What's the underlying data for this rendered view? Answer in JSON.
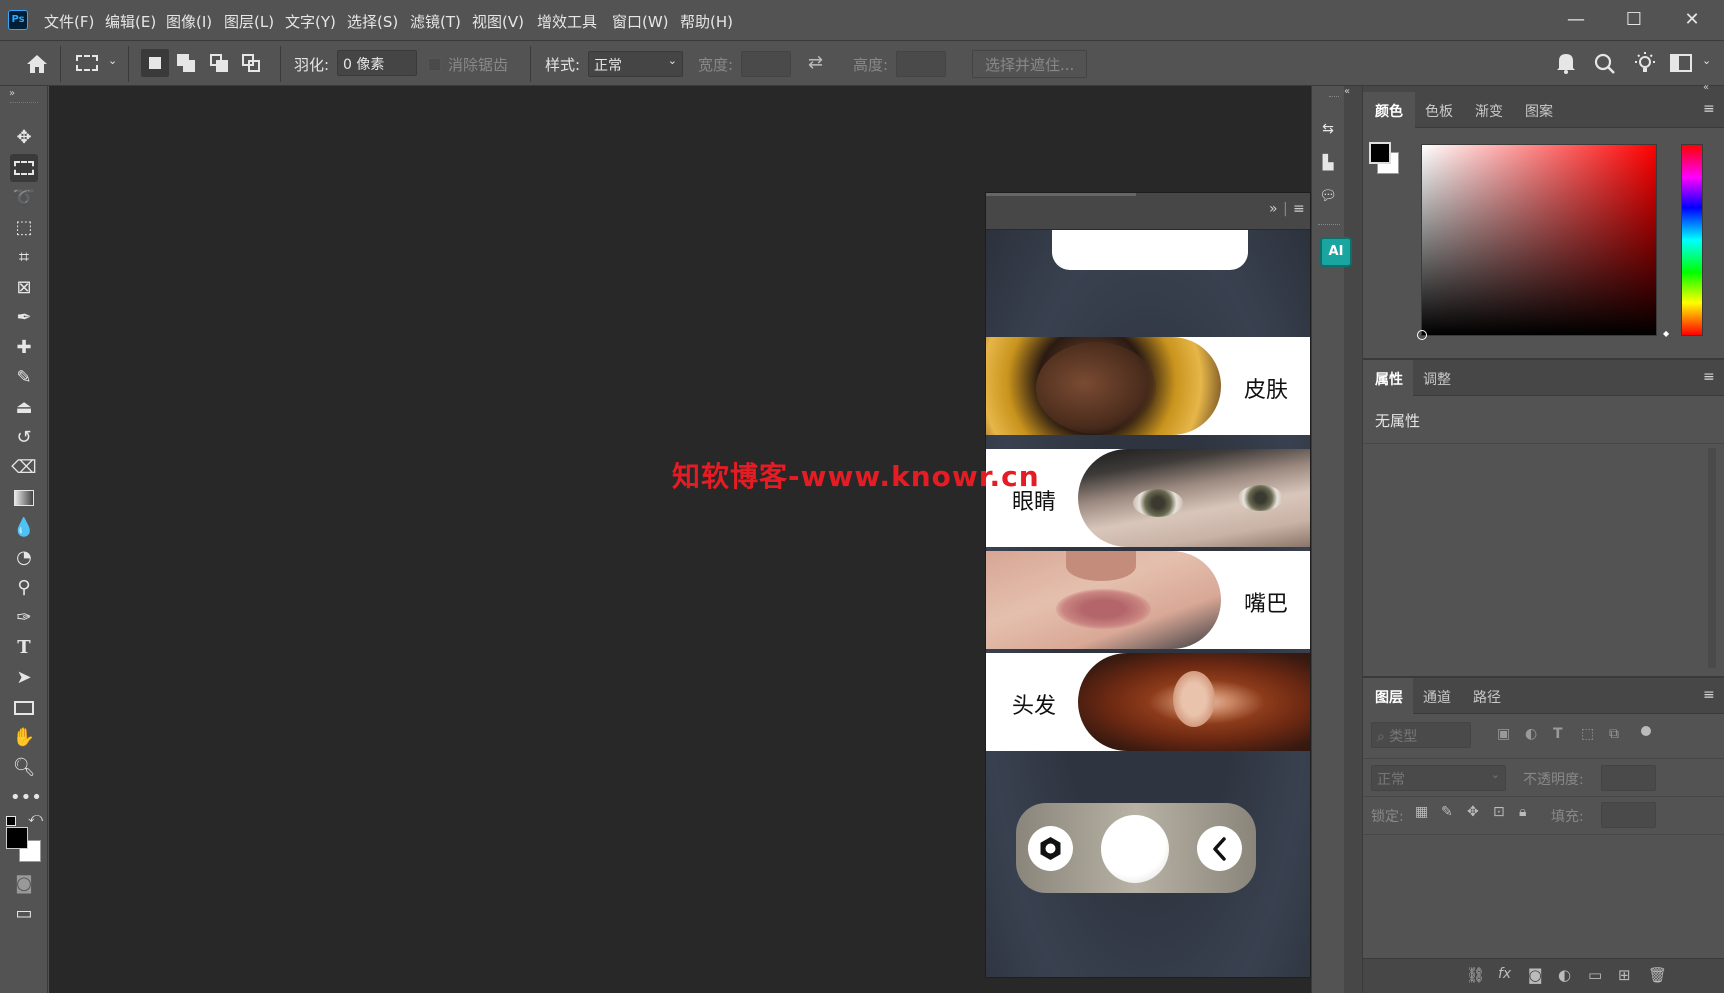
{
  "app": {
    "logo": "Ps"
  },
  "menu": [
    "文件(F)",
    "编辑(E)",
    "图像(I)",
    "图层(L)",
    "文字(Y)",
    "选择(S)",
    "滤镜(T)",
    "视图(V)",
    "增效工具",
    "窗口(W)",
    "帮助(H)"
  ],
  "window_controls": {
    "minimize": "—",
    "maximize": "☐",
    "close": "✕"
  },
  "options": {
    "feather_label": "羽化:",
    "feather_value": "0 像素",
    "antialias_label": "消除锯齿",
    "style_label": "样式:",
    "style_value": "正常",
    "width_label": "宽度:",
    "height_label": "高度:",
    "select_mask_label": "选择并遮住..."
  },
  "color_panel": {
    "tabs": [
      "颜色",
      "色板",
      "渐变",
      "图案"
    ],
    "active": "颜色",
    "foreground": "#000000",
    "background": "#ffffff"
  },
  "properties_panel": {
    "tabs": [
      "属性",
      "调整"
    ],
    "active": "属性",
    "content": "无属性"
  },
  "layers_panel": {
    "tabs": [
      "图层",
      "通道",
      "路径"
    ],
    "active": "图层",
    "filter_placeholder": "类型",
    "blend_mode": "正常",
    "opacity_label": "不透明度:",
    "lock_label": "锁定:",
    "fill_label": "填充:"
  },
  "plugin": {
    "items": [
      {
        "label": "皮肤",
        "side": "right"
      },
      {
        "label": "眼睛",
        "side": "left"
      },
      {
        "label": "嘴巴",
        "side": "right"
      },
      {
        "label": "头发",
        "side": "left"
      }
    ]
  },
  "watermark": "知软博客-www.knowr.cn"
}
